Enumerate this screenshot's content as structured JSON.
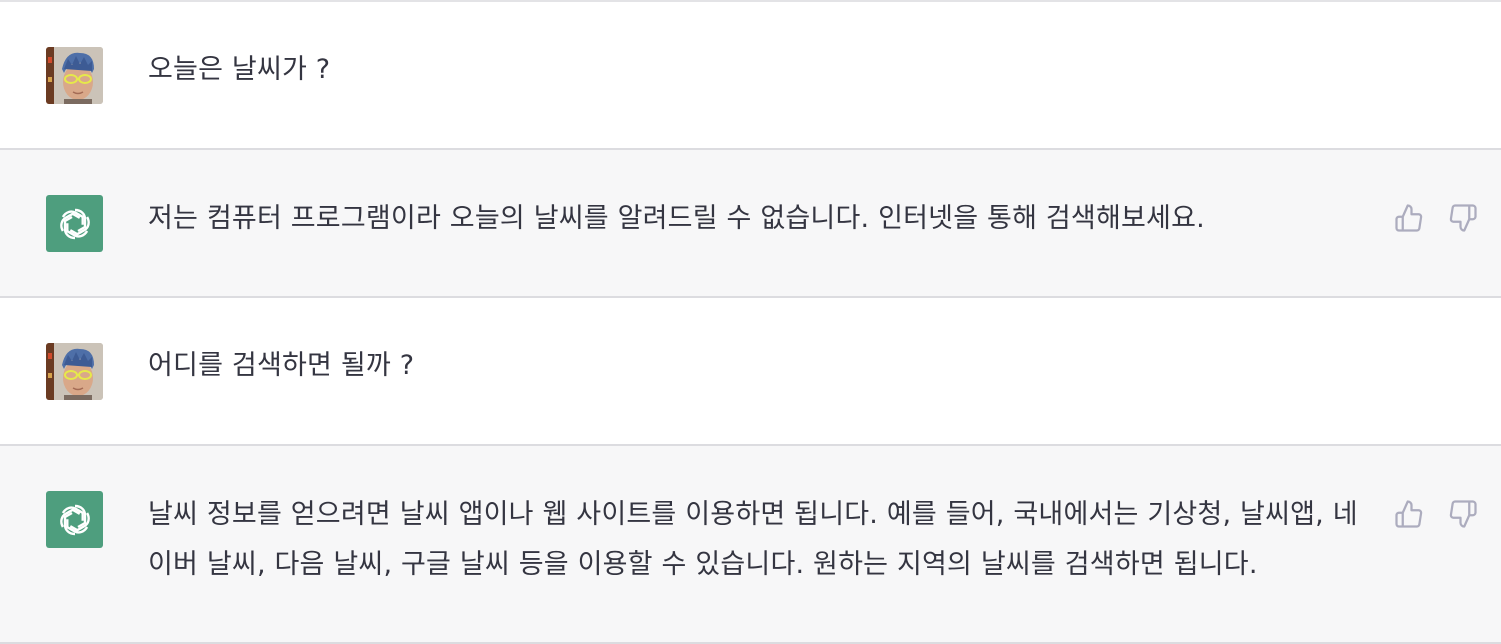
{
  "messages": [
    {
      "role": "user",
      "text": "오늘은 날씨가 ?"
    },
    {
      "role": "assistant",
      "text": "저는 컴퓨터 프로그램이라 오늘의 날씨를 알려드릴 수 없습니다. 인터넷을 통해 검색해보세요."
    },
    {
      "role": "user",
      "text": "어디를 검색하면 될까 ?"
    },
    {
      "role": "assistant",
      "text": "날씨 정보를 얻으려면 날씨 앱이나 웹 사이트를 이용하면 됩니다. 예를 들어, 국내에서는 기상청, 날씨앱, 네이버 날씨, 다음 날씨, 구글 날씨 등을 이용할 수 있습니다. 원하는 지역의 날씨를 검색하면 됩니다."
    }
  ],
  "icons": {
    "user_avatar": "user-avatar-icon",
    "assistant_avatar": "openai-logo-icon",
    "thumbs_up": "thumbs-up-icon",
    "thumbs_down": "thumbs-down-icon"
  },
  "colors": {
    "assistant_bg": "#f7f7f8",
    "user_bg": "#ffffff",
    "logo_bg": "#4e9e7e",
    "text": "#343541",
    "icon": "#acacbe"
  }
}
